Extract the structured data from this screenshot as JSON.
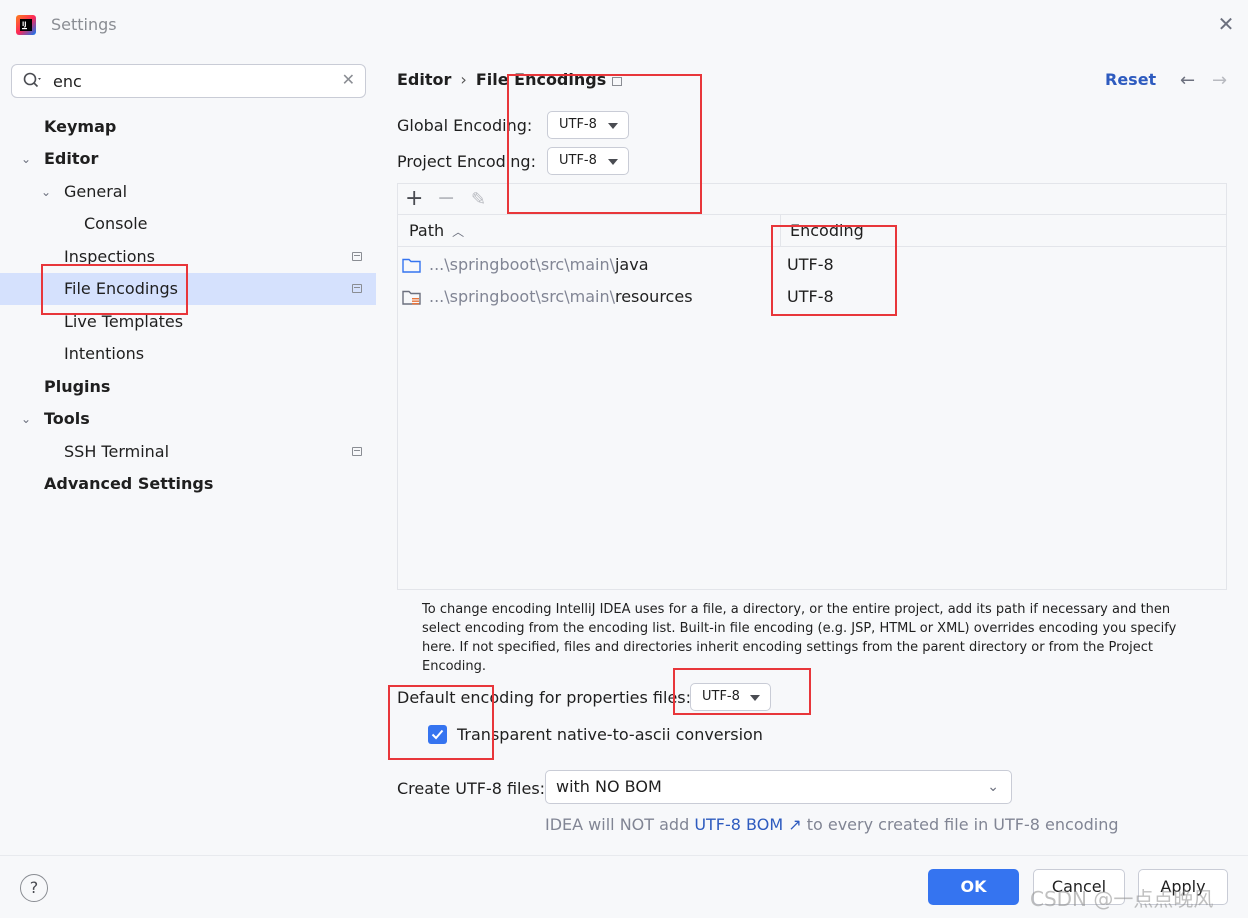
{
  "window": {
    "title": "Settings",
    "app_icon": "intellij-idea-icon",
    "close_label": "✕"
  },
  "sidebar": {
    "search": {
      "value": "enc",
      "icon": "search-icon"
    },
    "items": [
      {
        "label": "Keymap"
      },
      {
        "label": "Editor"
      },
      {
        "label": "General"
      },
      {
        "label": "Console"
      },
      {
        "label": "Inspections"
      },
      {
        "label": "File Encodings"
      },
      {
        "label": "Live Templates"
      },
      {
        "label": "Intentions"
      },
      {
        "label": "Plugins"
      },
      {
        "label": "Tools"
      },
      {
        "label": "SSH Terminal"
      },
      {
        "label": "Advanced Settings"
      }
    ]
  },
  "header": {
    "breadcrumb_parent": "Editor",
    "breadcrumb_separator": "›",
    "breadcrumb_current": "File Encodings",
    "reset_label": "Reset",
    "back": "←",
    "forward": "→"
  },
  "settings": {
    "global_encoding_label": "Global Encoding:",
    "global_encoding_value": "UTF-8",
    "project_encoding_label": "Project Encoding:",
    "project_encoding_value": "UTF-8",
    "toolbar": {
      "add": "+",
      "remove": "−",
      "edit": "✎"
    },
    "table": {
      "col_path": "Path",
      "col_encoding": "Encoding",
      "rows": [
        {
          "path_prefix": "...\\springboot\\src\\main\\",
          "path_leaf": "java",
          "encoding": "UTF-8",
          "icon": "folder-icon"
        },
        {
          "path_prefix": "...\\springboot\\src\\main\\",
          "path_leaf": "resources",
          "encoding": "UTF-8",
          "icon": "resources-folder-icon"
        }
      ]
    },
    "help_text": "To change encoding IntelliJ IDEA uses for a file, a directory, or the entire project, add its path if necessary and then select encoding from the encoding list. Built-in file encoding (e.g. JSP, HTML or XML) overrides encoding you specify here. If not specified, files and directories inherit encoding settings from the parent directory or from the Project Encoding.",
    "properties_label": "Default encoding for properties files:",
    "properties_value": "UTF-8",
    "native_to_ascii_label": "Transparent native-to-ascii conversion",
    "native_to_ascii_checked": true,
    "create_utf8_label": "Create UTF-8 files:",
    "create_utf8_value": "with NO BOM",
    "hint_before": "IDEA will NOT add ",
    "hint_link": "UTF-8 BOM ↗",
    "hint_after": " to every created file in UTF-8 encoding"
  },
  "footer": {
    "help": "?",
    "ok": "OK",
    "cancel": "Cancel",
    "apply": "Apply"
  },
  "watermark": "CSDN @一点点晚风",
  "colors": {
    "accent": "#3574f0",
    "link": "#2e5bbf",
    "selection": "#d5e1fd",
    "annotation": "#e8363a"
  }
}
